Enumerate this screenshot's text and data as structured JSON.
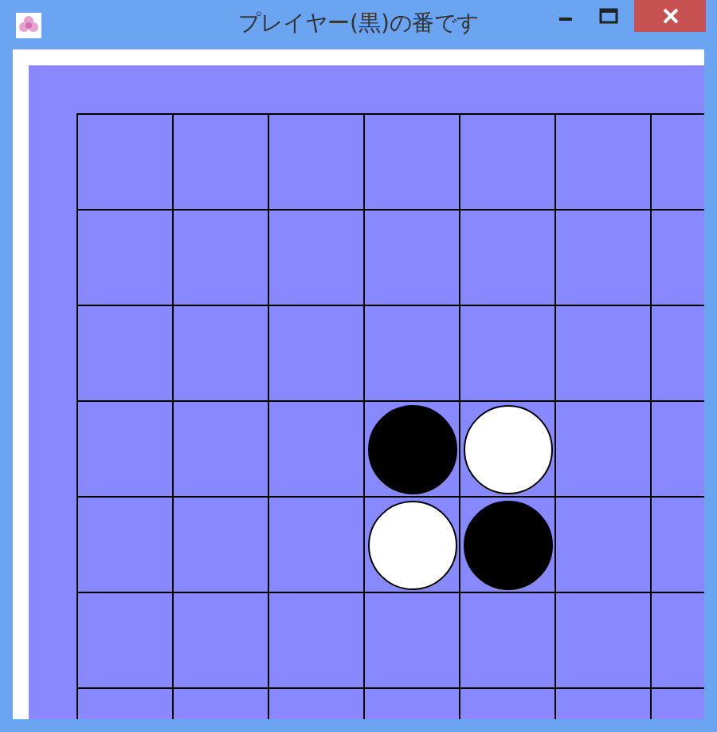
{
  "window": {
    "title": "プレイヤー(黒)の番です"
  },
  "board": {
    "rows": [
      [
        {
          "kind": "empty"
        },
        {
          "kind": "empty"
        },
        {
          "kind": "empty"
        },
        {
          "kind": "empty"
        },
        {
          "kind": "empty"
        },
        {
          "kind": "empty"
        },
        {
          "kind": "empty"
        }
      ],
      [
        {
          "kind": "empty"
        },
        {
          "kind": "empty"
        },
        {
          "kind": "empty"
        },
        {
          "kind": "empty"
        },
        {
          "kind": "empty"
        },
        {
          "kind": "empty"
        },
        {
          "kind": "empty"
        }
      ],
      [
        {
          "kind": "empty"
        },
        {
          "kind": "empty"
        },
        {
          "kind": "empty"
        },
        {
          "kind": "empty"
        },
        {
          "kind": "empty"
        },
        {
          "kind": "empty"
        },
        {
          "kind": "empty"
        }
      ],
      [
        {
          "kind": "empty"
        },
        {
          "kind": "empty"
        },
        {
          "kind": "empty"
        },
        {
          "kind": "black"
        },
        {
          "kind": "white"
        },
        {
          "kind": "empty"
        },
        {
          "kind": "empty"
        }
      ],
      [
        {
          "kind": "empty"
        },
        {
          "kind": "empty"
        },
        {
          "kind": "empty"
        },
        {
          "kind": "white"
        },
        {
          "kind": "black"
        },
        {
          "kind": "empty"
        },
        {
          "kind": "empty"
        }
      ],
      [
        {
          "kind": "empty"
        },
        {
          "kind": "empty"
        },
        {
          "kind": "empty"
        },
        {
          "kind": "empty"
        },
        {
          "kind": "empty"
        },
        {
          "kind": "empty"
        },
        {
          "kind": "empty"
        }
      ],
      [
        {
          "kind": "empty"
        },
        {
          "kind": "empty"
        },
        {
          "kind": "empty"
        },
        {
          "kind": "empty"
        },
        {
          "kind": "empty"
        },
        {
          "kind": "empty"
        },
        {
          "kind": "empty"
        }
      ]
    ]
  }
}
